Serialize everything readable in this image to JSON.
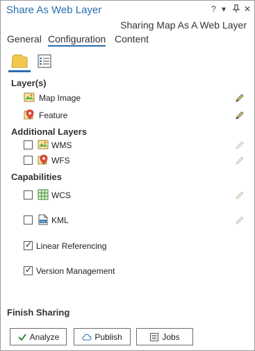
{
  "window": {
    "title": "Share As Web Layer",
    "controls": {
      "help": "?",
      "menu": "▾",
      "pin": "⊥",
      "close": "✕"
    }
  },
  "subtitle": "Sharing Map As A Web Layer",
  "tabs": [
    {
      "label": "General",
      "active": false
    },
    {
      "label": "Configuration",
      "active": true
    },
    {
      "label": "Content",
      "active": false
    }
  ],
  "subtabs": [
    {
      "icon": "layers-folder-icon",
      "active": true
    },
    {
      "icon": "properties-list-icon",
      "active": false
    }
  ],
  "layers": {
    "heading": "Layer(s)",
    "items": [
      {
        "label": "Map Image",
        "icon": "map-image-icon"
      },
      {
        "label": "Feature",
        "icon": "feature-icon"
      }
    ]
  },
  "additional_layers": {
    "heading": "Additional Layers",
    "items": [
      {
        "label": "WMS",
        "icon": "map-image-icon",
        "checked": false
      },
      {
        "label": "WFS",
        "icon": "feature-icon",
        "checked": false
      }
    ]
  },
  "capabilities": {
    "heading": "Capabilities",
    "items": [
      {
        "label": "WCS",
        "icon": "grid-icon",
        "checked": false
      },
      {
        "label": "KML",
        "icon": "kml-icon",
        "checked": false
      },
      {
        "label": "Linear Referencing",
        "checked": true
      },
      {
        "label": "Version Management",
        "checked": true
      }
    ]
  },
  "finish": {
    "heading": "Finish Sharing",
    "analyze_label": "Analyze",
    "publish_label": "Publish",
    "jobs_label": "Jobs"
  },
  "colors": {
    "accent": "#2b6cb0",
    "title": "#2b6cb0",
    "edit_pencil_active": "#6a6a6a",
    "edit_pencil_disabled": "#c8c8c8"
  }
}
